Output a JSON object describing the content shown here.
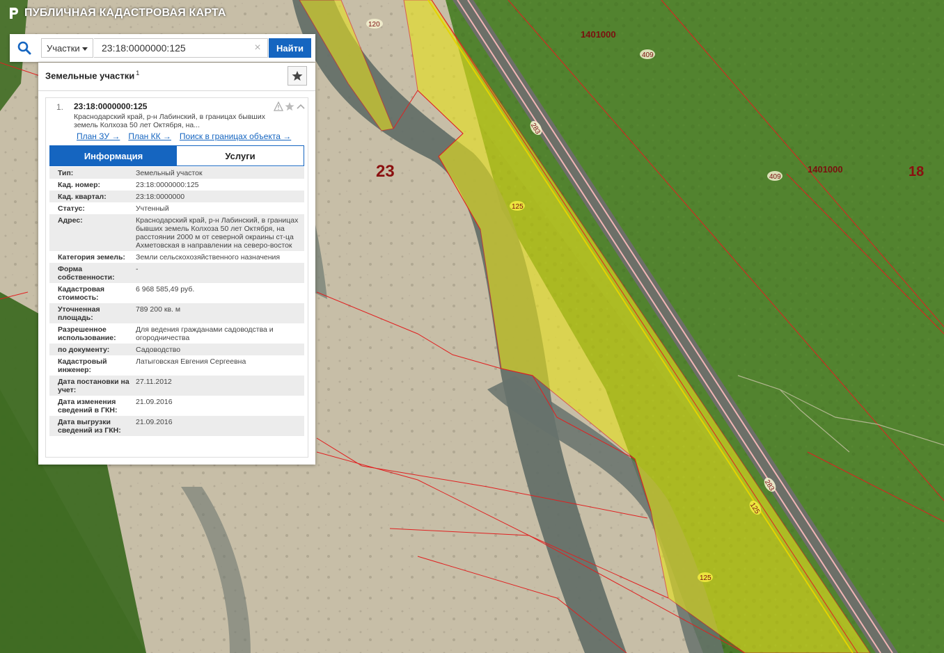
{
  "header": {
    "title": "ПУБЛИЧНАЯ КАДАСТРОВАЯ КАРТА"
  },
  "search": {
    "type_label": "Участки",
    "value": "23:18:0000000:125",
    "find_label": "Найти"
  },
  "panel": {
    "title": "Земельные участки",
    "count": "1",
    "result": {
      "index": "1.",
      "number": "23:18:0000000:125",
      "description": "Краснодарский край, р-н Лабинский, в границах бывших земель Колхоза 50 лет Октября, на...",
      "links": [
        "План ЗУ →",
        "План КК →",
        "Поиск в границах объекта →"
      ],
      "tabs": [
        "Информация",
        "Услуги"
      ],
      "info": [
        {
          "key": "Тип:",
          "value": "Земельный участок"
        },
        {
          "key": "Кад. номер:",
          "value": "23:18:0000000:125",
          "link": true
        },
        {
          "key": "Кад. квартал:",
          "value": "23:18:0000000",
          "link": true
        },
        {
          "key": "Статус:",
          "value": "Учтенный"
        },
        {
          "key": "Адрес:",
          "value": "Краснодарский край, р-н Лабинский, в границах бывших земель Колхоза 50 лет Октября, на расстоянии 2000 м от северной окраины ст-ца Ахметовская в направлении на северо-восток"
        },
        {
          "key": "Категория земель:",
          "value": "Земли сельскохозяйственного назначения"
        },
        {
          "key": "Форма собственности:",
          "value": "-"
        },
        {
          "key": "Кадастровая стоимость:",
          "value": "6 968 585,49 руб."
        },
        {
          "key": "Уточненная площадь:",
          "value": "789 200 кв. м"
        },
        {
          "key": "Разрешенное использование:",
          "value": "Для ведения гражданами садоводства и огородничества"
        },
        {
          "key": "по документу:",
          "value": "Садоводство"
        },
        {
          "key": "Кадастровый инженер:",
          "value": "Латыговская Евгения Сергеевна"
        },
        {
          "key": "Дата постановки на учет:",
          "value": "27.11.2012"
        },
        {
          "key": "Дата изменения сведений в ГКН:",
          "value": "21.09.2016"
        },
        {
          "key": "Дата выгрузки сведений из ГКН:",
          "value": "21.09.2016"
        }
      ]
    }
  },
  "map": {
    "labels": {
      "region": "23",
      "region2": "18",
      "quarter_a": "1401000",
      "quarter_b": "1401000",
      "parcel_125_a": "125",
      "parcel_125_b": "125",
      "parcel_125_c": "125",
      "parcel_120": "120",
      "parcel_409_a": "409",
      "parcel_409_b": "409",
      "road_a": "283",
      "road_b": "283"
    }
  },
  "colors": {
    "accent": "#1565c0",
    "boundary": "#e02020",
    "parcel_fill": "#e6e01e",
    "forest": "#4d7a2c"
  }
}
